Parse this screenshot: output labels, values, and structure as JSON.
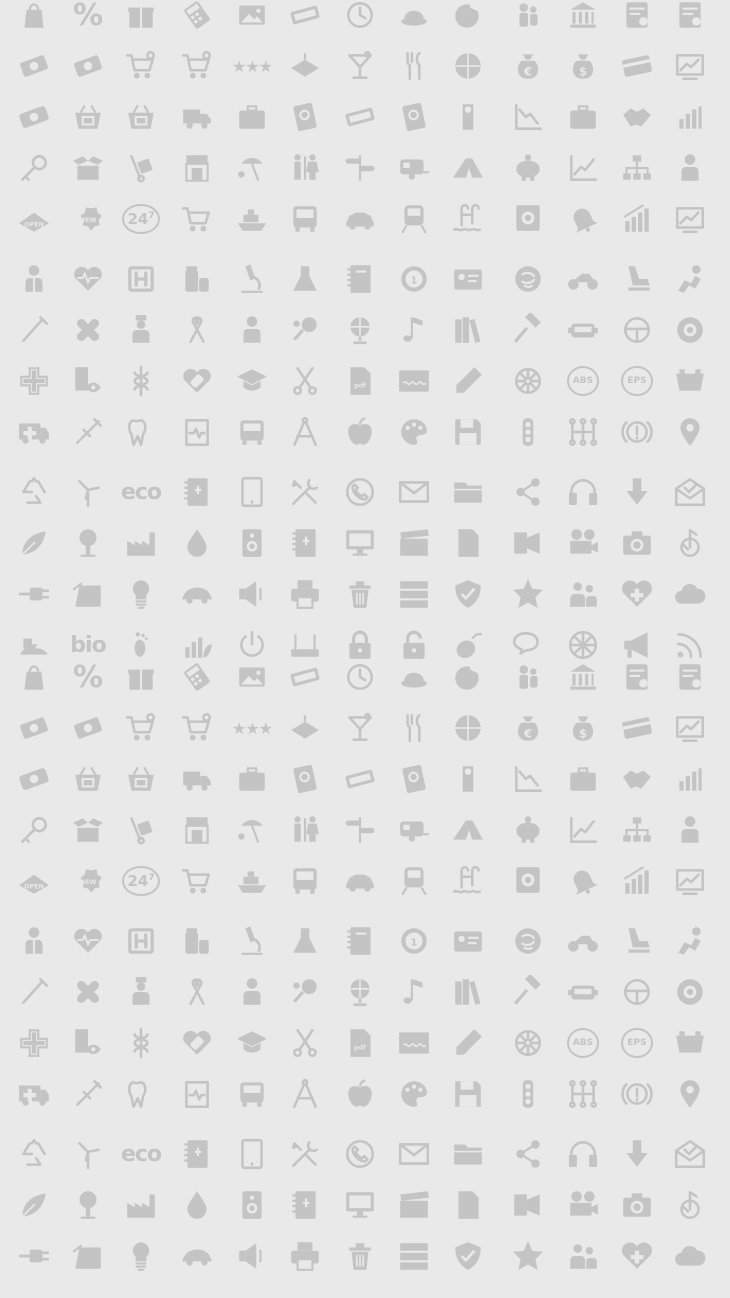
{
  "background_color": "#e9e9e9",
  "icon_color": "#c4c4c4",
  "pattern_rows": [
    [
      "shopping-bag-icon",
      "percent-icon",
      "gift-icon",
      "calculator-icon",
      "picture-icon",
      "ticket-icon",
      "clock-icon",
      "food-tray-icon",
      "globe-plane-icon",
      "people-icon",
      "bank-icon",
      "document-icon",
      "document-icon",
      "document-icon"
    ],
    [
      "money-icon",
      "money-icon",
      "cart-add-icon",
      "cart-add-icon",
      "stars-icon",
      "hotel-sign-icon",
      "cocktail-icon",
      "cutlery-icon",
      "basketball-icon",
      "euro-bag-icon",
      "dollar-bag-icon",
      "credit-card-icon",
      "chart-screen-icon",
      "credit-card-icon"
    ],
    [
      "banknote-icon",
      "basket-icon",
      "basket-icon",
      "truck-icon",
      "briefcase-icon",
      "passport-icon",
      "ticket-icon",
      "passport-icon",
      "door-hanger-icon",
      "chart-down-icon",
      "briefcase-icon",
      "handshake-icon",
      "bar-chart-icon",
      "bar-chart-icon"
    ],
    [
      "key-icon",
      "open-box-icon",
      "hand-truck-icon",
      "shop-icon",
      "beach-icon",
      "toilets-icon",
      "signpost-icon",
      "caravan-icon",
      "tent-icon",
      "piggy-bank-icon",
      "chart-up-icon",
      "hierarchy-icon",
      "person-icon",
      "person-icon"
    ],
    [
      "open-sign-icon",
      "new-badge-icon",
      "24-7-icon",
      "cart-icon",
      "ship-icon",
      "bus-icon",
      "car-icon",
      "train-icon",
      "swimming-pool-icon",
      "safe-icon",
      "bell-icon",
      "bar-chart-up-icon",
      "chart-screen-icon",
      "chart-screen-icon"
    ],
    [
      "doctor-icon",
      "heart-pulse-icon",
      "hospital-icon",
      "pills-icon",
      "microscope-icon",
      "flask-icon",
      "notebook-icon",
      "medal-icon",
      "id-card-icon",
      "swirl-icon",
      "motorcycle-icon",
      "car-seat-icon",
      "airbag-icon",
      "airbag-icon"
    ],
    [
      "thermometer-icon",
      "plaster-icon",
      "nurse-icon",
      "ribbon-icon",
      "person-icon",
      "tennis-icon",
      "globe-icon",
      "music-note-icon",
      "books-icon",
      "hammer-icon",
      "car-front-icon",
      "steering-wheel-icon",
      "tire-icon",
      "tire-icon"
    ],
    [
      "cross-icon",
      "eye-chart-icon",
      "caduceus-icon",
      "heart-plaster-icon",
      "graduation-cap-icon",
      "scissors-icon",
      "pdf-file-icon",
      "blackboard-icon",
      "pencil-icon",
      "wheel-icon",
      "abs-icon",
      "eps-icon",
      "battery-icon",
      "battery-icon"
    ],
    [
      "ambulance-icon",
      "syringe-icon",
      "tooth-icon",
      "clipboard-pulse-icon",
      "school-bus-icon",
      "compass-drawing-icon",
      "apple-icon",
      "palette-icon",
      "floppy-icon",
      "traffic-light-icon",
      "gear-stick-icon",
      "warning-circle-icon",
      "map-pin-icon",
      "map-pin-icon"
    ],
    [
      "recycle-icon",
      "wind-turbine-icon",
      "eco-icon",
      "address-book-icon",
      "tablet-icon",
      "tools-icon",
      "phone-icon",
      "mail-icon",
      "folder-icon",
      "share-icon",
      "headphones-icon",
      "download-icon",
      "open-mail-icon",
      "open-mail-icon"
    ],
    [
      "leaf-icon",
      "tree-icon",
      "factory-icon",
      "drop-icon",
      "speaker-icon",
      "address-book-icon",
      "monitor-icon",
      "clapperboard-icon",
      "file-icon",
      "projector-icon",
      "camera-reel-icon",
      "camera-icon",
      "music-icon",
      "music-icon"
    ],
    [
      "plug-icon",
      "solar-panel-icon",
      "bulb-icon",
      "eco-car-icon",
      "volume-icon",
      "printer-icon",
      "trash-icon",
      "server-icon",
      "shield-icon",
      "star-icon",
      "users-icon",
      "heart-plus-icon",
      "cloud-icon",
      "cloud-icon"
    ],
    [
      "bio-leaf-icon",
      "bio-icon",
      "footprint-icon",
      "green-chart-icon",
      "power-icon",
      "router-icon",
      "lock-icon",
      "unlock-icon",
      "mouse-icon",
      "chat-icon",
      "compass-icon",
      "megaphone-icon",
      "rss-icon",
      "rss-icon"
    ]
  ]
}
